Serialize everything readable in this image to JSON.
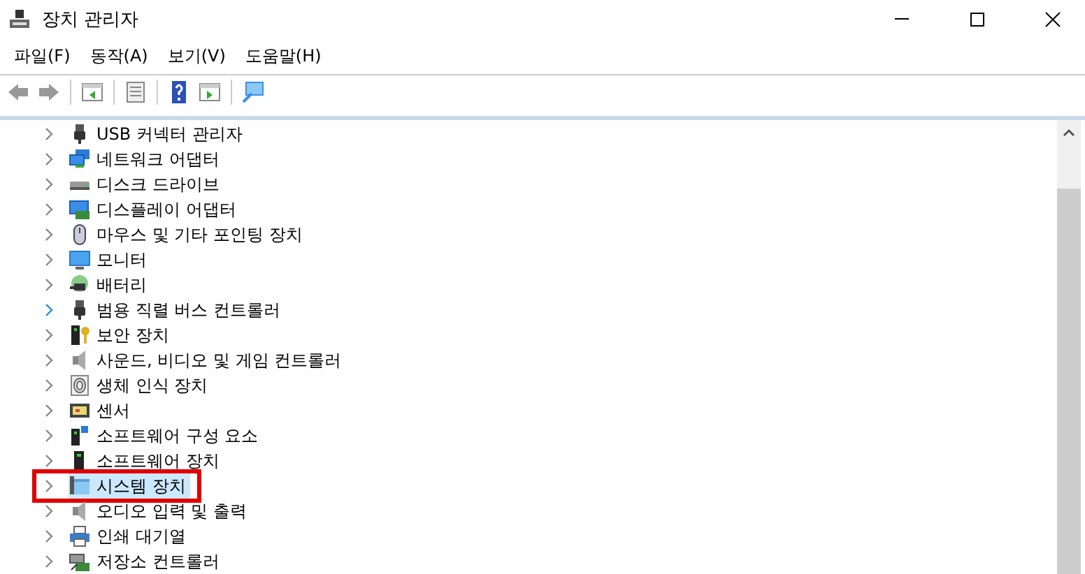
{
  "window": {
    "title": "장치 관리자"
  },
  "menu": [
    "파일(F)",
    "동작(A)",
    "보기(V)",
    "도움말(H)"
  ],
  "toolbar": [
    {
      "kind": "back"
    },
    {
      "kind": "forward"
    },
    {
      "kind": "sep"
    },
    {
      "kind": "tree"
    },
    {
      "kind": "sep"
    },
    {
      "kind": "props"
    },
    {
      "kind": "sep"
    },
    {
      "kind": "help"
    },
    {
      "kind": "pane"
    },
    {
      "kind": "sep"
    },
    {
      "kind": "scan"
    }
  ],
  "tree": {
    "items": [
      {
        "label": "USB 커넥터 관리자",
        "kind": "usb",
        "selected": false,
        "hovered": false,
        "outlined": false
      },
      {
        "label": "네트워크 어댑터",
        "kind": "network",
        "selected": false,
        "hovered": false,
        "outlined": false
      },
      {
        "label": "디스크 드라이브",
        "kind": "disk",
        "selected": false,
        "hovered": false,
        "outlined": false
      },
      {
        "label": "디스플레이 어댑터",
        "kind": "display",
        "selected": false,
        "hovered": false,
        "outlined": false
      },
      {
        "label": "마우스 및 기타 포인팅 장치",
        "kind": "mouse",
        "selected": false,
        "hovered": false,
        "outlined": false
      },
      {
        "label": "모니터",
        "kind": "monitor",
        "selected": false,
        "hovered": false,
        "outlined": false
      },
      {
        "label": "배터리",
        "kind": "battery",
        "selected": false,
        "hovered": false,
        "outlined": false
      },
      {
        "label": "범용 직렬 버스 컨트롤러",
        "kind": "usb",
        "selected": false,
        "hovered": true,
        "outlined": false
      },
      {
        "label": "보안 장치",
        "kind": "security",
        "selected": false,
        "hovered": false,
        "outlined": false
      },
      {
        "label": "사운드, 비디오 및 게임 컨트롤러",
        "kind": "speaker",
        "selected": false,
        "hovered": false,
        "outlined": false
      },
      {
        "label": "생체 인식 장치",
        "kind": "fingerprint",
        "selected": false,
        "hovered": false,
        "outlined": false
      },
      {
        "label": "센서",
        "kind": "sensor",
        "selected": false,
        "hovered": false,
        "outlined": false
      },
      {
        "label": "소프트웨어 구성 요소",
        "kind": "component",
        "selected": false,
        "hovered": false,
        "outlined": false
      },
      {
        "label": "소프트웨어 장치",
        "kind": "softdevice",
        "selected": false,
        "hovered": false,
        "outlined": false
      },
      {
        "label": "시스템 장치",
        "kind": "system",
        "selected": true,
        "hovered": false,
        "outlined": true
      },
      {
        "label": "오디오 입력 및 출력",
        "kind": "speaker",
        "selected": false,
        "hovered": false,
        "outlined": false
      },
      {
        "label": "인쇄 대기열",
        "kind": "printer",
        "selected": false,
        "hovered": false,
        "outlined": false
      },
      {
        "label": "저장소 컨트롤러",
        "kind": "storage",
        "selected": false,
        "hovered": false,
        "outlined": false
      }
    ]
  }
}
